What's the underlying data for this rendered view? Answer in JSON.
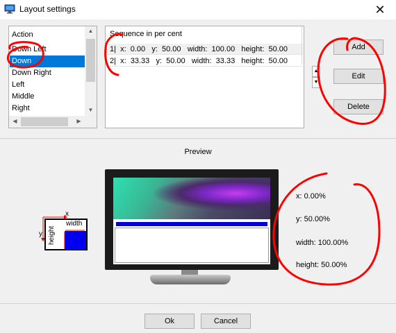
{
  "window": {
    "title": "Layout settings",
    "close": "✕",
    "app_icon": "monitor-icon"
  },
  "action_list": {
    "header": "Action",
    "items": [
      "Down Left",
      "Down",
      "Down Right",
      "Left",
      "Middle",
      "Right"
    ],
    "selected": "Down"
  },
  "sequence": {
    "header": "Sequence in per cent",
    "rows": [
      "1|  x:  0.00   y:  50.00   width:  100.00   height:  50.00",
      "2|  x:  33.33   y:  50.00   width:  33.33   height:  50.00"
    ]
  },
  "buttons": {
    "add": "Add",
    "edit": "Edit",
    "delete": "Delete",
    "ok": "Ok",
    "cancel": "Cancel"
  },
  "preview": {
    "label": "Preview",
    "x": "x: 0.00%",
    "y": "y: 50.00%",
    "width": "width: 100.00%",
    "height": "height: 50.00%"
  },
  "diagram": {
    "x": "x",
    "y": "y",
    "width": "width",
    "height": "height"
  },
  "colors": {
    "selection": "#0078d7",
    "region": "#0000d8",
    "marker": "#ff0000"
  }
}
